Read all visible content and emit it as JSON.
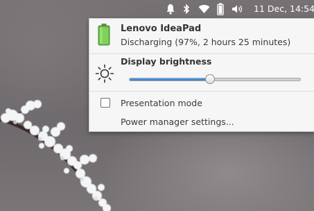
{
  "panel": {
    "clock": "11 Dec, 14:54",
    "tray_icons": [
      "bell-icon",
      "bluetooth-icon",
      "wifi-icon",
      "battery-icon",
      "volume-icon"
    ]
  },
  "power_menu": {
    "device_name": "Lenovo IdeaPad",
    "device_status": "Discharging (97%, 2 hours 25 minutes)",
    "battery_percent": 97,
    "brightness_label": "Display brightness",
    "brightness_level": 0.47,
    "presentation_mode_label": "Presentation mode",
    "presentation_mode_checked": false,
    "settings_label": "Power manager settings..."
  },
  "colors": {
    "battery_green": "#6cc04a",
    "slider_blue": "#3d86d4",
    "popover_bg": "#f6f6f6"
  }
}
